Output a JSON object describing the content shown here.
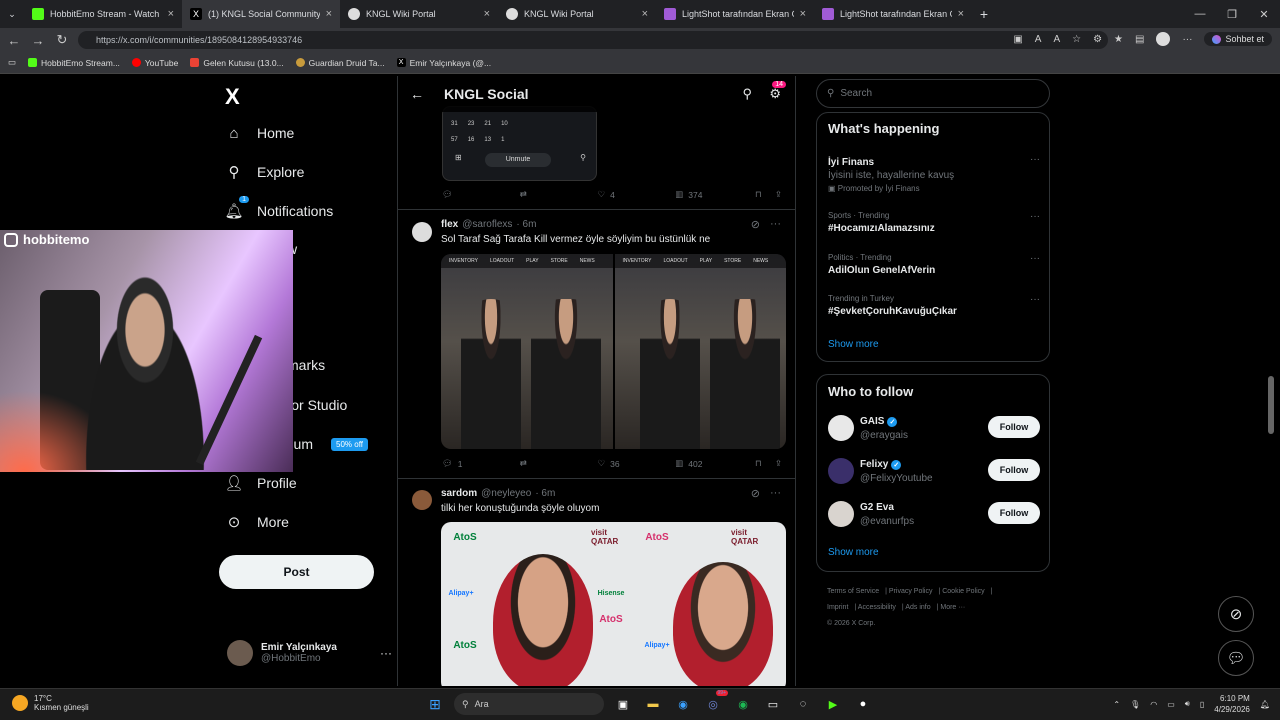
{
  "browser": {
    "tabs": [
      {
        "label": "HobbitEmo Stream - Watch Live o",
        "color": "#53fc18"
      },
      {
        "label": "(1) KNGL Social Community / X",
        "color": "#ffffff",
        "active": true
      },
      {
        "label": "KNGL Wiki Portal",
        "color": "#ffffff"
      },
      {
        "label": "KNGL Wiki Portal",
        "color": "#ffffff"
      },
      {
        "label": "LightShot tarafından Ekran Görünt",
        "color": "#a05bd6"
      },
      {
        "label": "LightShot tarafından Ekran Görünt",
        "color": "#a05bd6"
      }
    ],
    "new_tab": "+",
    "url": "https://x.com/i/communities/1895084128954933746",
    "sohbet": "Sohbet et",
    "bookmarks": [
      {
        "label": "HobbitEmo Stream...",
        "color": "#53fc18"
      },
      {
        "label": "YouTube",
        "color": "#ff0000"
      },
      {
        "label": "Gelen Kutusu (13.0...",
        "color": "#ea4335"
      },
      {
        "label": "Guardian Druid Ta...",
        "color": "#c89b3c"
      },
      {
        "label": "Emir Yalçınkaya (@...",
        "color": "#ffffff"
      }
    ]
  },
  "nav": {
    "logo": "X",
    "items": {
      "home": "Home",
      "explore": "Explore",
      "notifications": "Notifications",
      "messages": "w",
      "bookmarks": "marks",
      "creator": "Creator Studio",
      "premium": "Premium",
      "premium_badge": "50% off",
      "profile": "Profile",
      "more": "More"
    },
    "notif_count": "1",
    "post": "Post",
    "account": {
      "name": "Emir Yalçınkaya",
      "handle": "@HobbitEmo"
    }
  },
  "webcam": {
    "label": "hobbitemo"
  },
  "feed": {
    "title": "KNGL Social",
    "settings_badge": "14",
    "top_post": {
      "emoji_counts_1": [
        "31",
        "23",
        "21",
        "10"
      ],
      "emoji_counts_2": [
        "57",
        "16",
        "13",
        "1"
      ],
      "unmute": "Unmute",
      "replies": "",
      "likes": "4",
      "views": "374"
    },
    "post1": {
      "name": "flex",
      "handle": "@saroflexs",
      "time": "· 6m",
      "text": "Sol Taraf Sağ Tarafa Kill vermez öyle söyliyim bu üstünlük ne",
      "menu_labels": [
        "INVENTORY",
        "LOADOUT",
        "PLAY",
        "STORE",
        "NEWS"
      ],
      "replies": "1",
      "likes": "36",
      "views": "402"
    },
    "post2": {
      "name": "sardom",
      "handle": "@neyleyeo",
      "time": "· 6m",
      "text": "tilki her konuştuğunda şöyle oluyom",
      "tiles": [
        "AtoS",
        "visit QATAR",
        "Hisense",
        "Alipay+"
      ]
    }
  },
  "right": {
    "search_placeholder": "Search",
    "happening_title": "What's happening",
    "trends": [
      {
        "sub": "",
        "title": "İyi Finans",
        "desc": "İyisini iste, hayallerine kavuş",
        "promo": "Promoted by İyi Finans"
      },
      {
        "sub": "Sports · Trending",
        "title": "#HocamızıAlamazsınız"
      },
      {
        "sub": "Politics · Trending",
        "title": "AdilOlun GenelAfVerin"
      },
      {
        "sub": "Trending in Turkey",
        "title": "#ŞevketÇoruhKavuğuÇıkar"
      }
    ],
    "show_more_1": "Show more",
    "wtf_title": "Who to follow",
    "follow": [
      {
        "name": "GAIS",
        "handle": "@eraygais",
        "verified": true
      },
      {
        "name": "Felixy",
        "handle": "@FelixyYoutube",
        "verified": true
      },
      {
        "name": "G2 Eva",
        "handle": "@evanurfps",
        "verified": false
      }
    ],
    "follow_label": "Follow",
    "show_more_2": "Show more",
    "footer": [
      "Terms of Service",
      "Privacy Policy",
      "Cookie Policy",
      "Imprint",
      "Accessibility",
      "Ads info",
      "More ···",
      "© 2026 X Corp."
    ]
  },
  "taskbar": {
    "temp": "17°C",
    "weather": "Kısmen güneşli",
    "search": "Ara",
    "time": "6:10 PM",
    "date": "4/29/2026",
    "notif": "99+"
  }
}
